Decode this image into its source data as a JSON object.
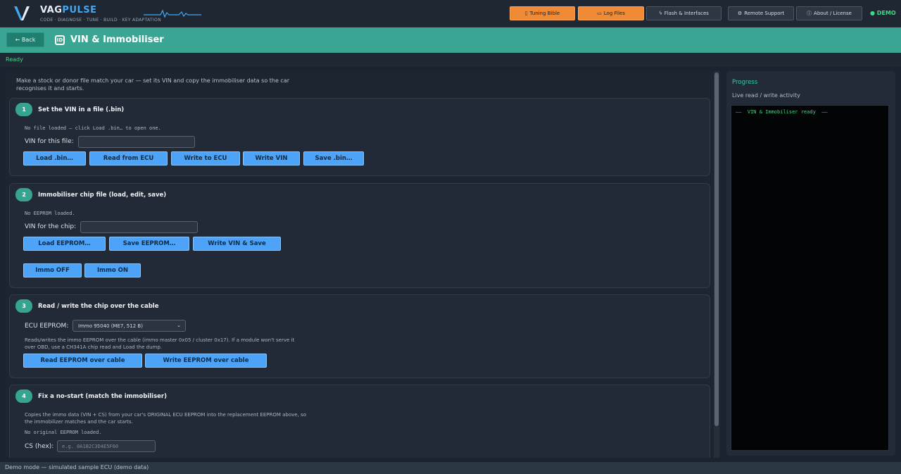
{
  "app": {
    "brand_a": "VAG",
    "brand_b": "PULSE",
    "tagline": "CODE · DIAGNOSE · TUNE · BUILD · KEY ADAPTATION",
    "demo_badge": "● DEMO"
  },
  "toolbar": {
    "tuning_bible": "Tuning Bible",
    "log_files": "Log Files",
    "flash_interfaces": "Flash & Interfaces",
    "remote_support": "Remote Support",
    "about_license": "About / License"
  },
  "icons": {
    "tuning_bible": "book-icon",
    "log_files": "folder-icon",
    "flash_interfaces": "lightning-icon",
    "remote_support": "support-icon",
    "about_license": "info-icon",
    "page": "id-card-icon"
  },
  "colors": {
    "accent_teal": "#3aa593",
    "action_blue": "#4da3f7",
    "orange": "#f08a34",
    "status_green": "#3ddc84"
  },
  "header": {
    "back_label": "← Back",
    "title": "VIN & Immobiliser"
  },
  "status": {
    "ready": "Ready"
  },
  "intro": "Make a stock or donor file match your car — set its VIN and copy the immobiliser data so the car recognises it and starts.",
  "section1": {
    "step": "1",
    "title": "Set the VIN in a file (.bin)",
    "status": "No file loaded — click  Load .bin…  to open one.",
    "vin_label": "VIN for this file:",
    "vin_value": "",
    "buttons": [
      "Load .bin…",
      "Read from ECU",
      "Write to ECU",
      "Write VIN",
      "Save .bin…"
    ]
  },
  "section2": {
    "step": "2",
    "title": "Immobiliser chip file (load, edit, save)",
    "status": "No EEPROM loaded.",
    "vin_label": "VIN for the chip:",
    "vin_value": "",
    "buttons": [
      "Load EEPROM…",
      "Save EEPROM…",
      "Write VIN & Save"
    ],
    "immo_off": "Immo OFF",
    "immo_on": "Immo ON"
  },
  "section3": {
    "step": "3",
    "title": "Read / write the chip over the cable",
    "ecu_label": "ECU EEPROM:",
    "ecu_selected": "Immo 95040 (ME7, 512 B)",
    "note": "Reads/writes the immo EEPROM over the cable (immo master 0x05 / cluster 0x17). If a module won't serve it over OBD, use a CH341A chip read and Load the dump.",
    "read_button": "Read EEPROM over cable",
    "write_button": "Write EEPROM over cable"
  },
  "section4": {
    "step": "4",
    "title": "Fix a no-start (match the immobiliser)",
    "note": "Copies the immo data (VIN + CS) from your car's ORIGINAL ECU EEPROM into the replacement EEPROM above, so the immobilizer matches and the car starts.",
    "status": "No original EEPROM loaded.",
    "cs_label": "CS (hex):",
    "cs_placeholder": "e.g. 0A1B2C3D4E5F60"
  },
  "progress": {
    "title": "Progress",
    "subtitle": "Live read / write activity",
    "console_line": "——  VIN & Immobiliser ready  ——"
  },
  "footer": {
    "text": "Demo mode — simulated sample ECU (demo data)"
  }
}
